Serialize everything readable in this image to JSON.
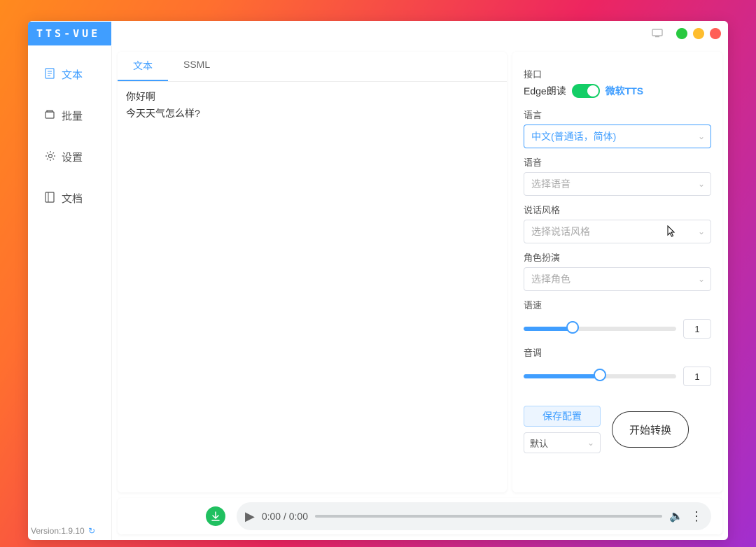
{
  "header": {
    "app_title": "TTS-VUE"
  },
  "sidebar": {
    "items": [
      {
        "label": "文本"
      },
      {
        "label": "批量"
      },
      {
        "label": "设置"
      },
      {
        "label": "文档"
      }
    ],
    "version_prefix": "Version:",
    "version_value": "1.9.10"
  },
  "editor": {
    "tabs": [
      {
        "label": "文本",
        "active": true
      },
      {
        "label": "SSML",
        "active": false
      }
    ],
    "text_line1": "你好啊",
    "text_line2": "今天天气怎么样?"
  },
  "settings": {
    "interface_label": "接口",
    "edge_label": "Edge朗读",
    "ms_tts_label": "微软TTS",
    "language_label": "语言",
    "language_value": "中文(普通话，简体)",
    "voice_label": "语音",
    "voice_placeholder": "选择语音",
    "style_label": "说话风格",
    "style_placeholder": "选择说话风格",
    "role_label": "角色扮演",
    "role_placeholder": "选择角色",
    "speed_label": "语速",
    "speed_value": "1",
    "pitch_label": "音调",
    "pitch_value": "1",
    "save_config_label": "保存配置",
    "preset_value": "默认",
    "convert_label": "开始转换"
  },
  "player": {
    "time_text": "0:00 / 0:00"
  }
}
